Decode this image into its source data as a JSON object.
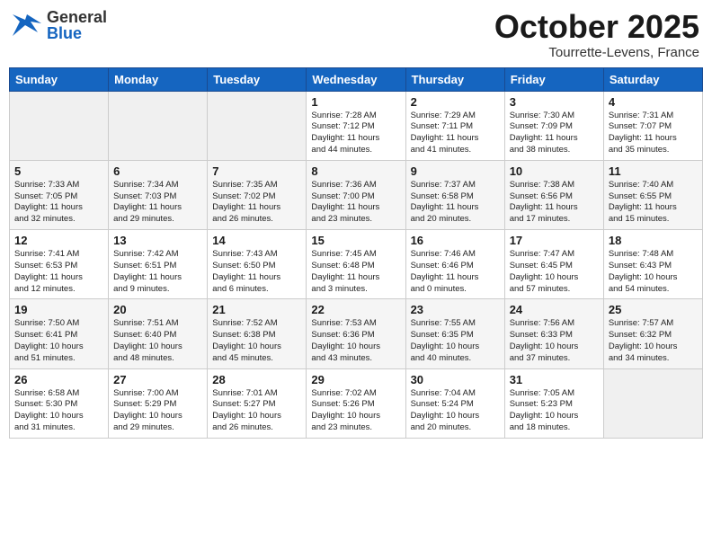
{
  "header": {
    "logo_general": "General",
    "logo_blue": "Blue",
    "month": "October 2025",
    "location": "Tourrette-Levens, France"
  },
  "days_of_week": [
    "Sunday",
    "Monday",
    "Tuesday",
    "Wednesday",
    "Thursday",
    "Friday",
    "Saturday"
  ],
  "weeks": [
    [
      {
        "day": "",
        "info": ""
      },
      {
        "day": "",
        "info": ""
      },
      {
        "day": "",
        "info": ""
      },
      {
        "day": "1",
        "info": "Sunrise: 7:28 AM\nSunset: 7:12 PM\nDaylight: 11 hours\nand 44 minutes."
      },
      {
        "day": "2",
        "info": "Sunrise: 7:29 AM\nSunset: 7:11 PM\nDaylight: 11 hours\nand 41 minutes."
      },
      {
        "day": "3",
        "info": "Sunrise: 7:30 AM\nSunset: 7:09 PM\nDaylight: 11 hours\nand 38 minutes."
      },
      {
        "day": "4",
        "info": "Sunrise: 7:31 AM\nSunset: 7:07 PM\nDaylight: 11 hours\nand 35 minutes."
      }
    ],
    [
      {
        "day": "5",
        "info": "Sunrise: 7:33 AM\nSunset: 7:05 PM\nDaylight: 11 hours\nand 32 minutes."
      },
      {
        "day": "6",
        "info": "Sunrise: 7:34 AM\nSunset: 7:03 PM\nDaylight: 11 hours\nand 29 minutes."
      },
      {
        "day": "7",
        "info": "Sunrise: 7:35 AM\nSunset: 7:02 PM\nDaylight: 11 hours\nand 26 minutes."
      },
      {
        "day": "8",
        "info": "Sunrise: 7:36 AM\nSunset: 7:00 PM\nDaylight: 11 hours\nand 23 minutes."
      },
      {
        "day": "9",
        "info": "Sunrise: 7:37 AM\nSunset: 6:58 PM\nDaylight: 11 hours\nand 20 minutes."
      },
      {
        "day": "10",
        "info": "Sunrise: 7:38 AM\nSunset: 6:56 PM\nDaylight: 11 hours\nand 17 minutes."
      },
      {
        "day": "11",
        "info": "Sunrise: 7:40 AM\nSunset: 6:55 PM\nDaylight: 11 hours\nand 15 minutes."
      }
    ],
    [
      {
        "day": "12",
        "info": "Sunrise: 7:41 AM\nSunset: 6:53 PM\nDaylight: 11 hours\nand 12 minutes."
      },
      {
        "day": "13",
        "info": "Sunrise: 7:42 AM\nSunset: 6:51 PM\nDaylight: 11 hours\nand 9 minutes."
      },
      {
        "day": "14",
        "info": "Sunrise: 7:43 AM\nSunset: 6:50 PM\nDaylight: 11 hours\nand 6 minutes."
      },
      {
        "day": "15",
        "info": "Sunrise: 7:45 AM\nSunset: 6:48 PM\nDaylight: 11 hours\nand 3 minutes."
      },
      {
        "day": "16",
        "info": "Sunrise: 7:46 AM\nSunset: 6:46 PM\nDaylight: 11 hours\nand 0 minutes."
      },
      {
        "day": "17",
        "info": "Sunrise: 7:47 AM\nSunset: 6:45 PM\nDaylight: 10 hours\nand 57 minutes."
      },
      {
        "day": "18",
        "info": "Sunrise: 7:48 AM\nSunset: 6:43 PM\nDaylight: 10 hours\nand 54 minutes."
      }
    ],
    [
      {
        "day": "19",
        "info": "Sunrise: 7:50 AM\nSunset: 6:41 PM\nDaylight: 10 hours\nand 51 minutes."
      },
      {
        "day": "20",
        "info": "Sunrise: 7:51 AM\nSunset: 6:40 PM\nDaylight: 10 hours\nand 48 minutes."
      },
      {
        "day": "21",
        "info": "Sunrise: 7:52 AM\nSunset: 6:38 PM\nDaylight: 10 hours\nand 45 minutes."
      },
      {
        "day": "22",
        "info": "Sunrise: 7:53 AM\nSunset: 6:36 PM\nDaylight: 10 hours\nand 43 minutes."
      },
      {
        "day": "23",
        "info": "Sunrise: 7:55 AM\nSunset: 6:35 PM\nDaylight: 10 hours\nand 40 minutes."
      },
      {
        "day": "24",
        "info": "Sunrise: 7:56 AM\nSunset: 6:33 PM\nDaylight: 10 hours\nand 37 minutes."
      },
      {
        "day": "25",
        "info": "Sunrise: 7:57 AM\nSunset: 6:32 PM\nDaylight: 10 hours\nand 34 minutes."
      }
    ],
    [
      {
        "day": "26",
        "info": "Sunrise: 6:58 AM\nSunset: 5:30 PM\nDaylight: 10 hours\nand 31 minutes."
      },
      {
        "day": "27",
        "info": "Sunrise: 7:00 AM\nSunset: 5:29 PM\nDaylight: 10 hours\nand 29 minutes."
      },
      {
        "day": "28",
        "info": "Sunrise: 7:01 AM\nSunset: 5:27 PM\nDaylight: 10 hours\nand 26 minutes."
      },
      {
        "day": "29",
        "info": "Sunrise: 7:02 AM\nSunset: 5:26 PM\nDaylight: 10 hours\nand 23 minutes."
      },
      {
        "day": "30",
        "info": "Sunrise: 7:04 AM\nSunset: 5:24 PM\nDaylight: 10 hours\nand 20 minutes."
      },
      {
        "day": "31",
        "info": "Sunrise: 7:05 AM\nSunset: 5:23 PM\nDaylight: 10 hours\nand 18 minutes."
      },
      {
        "day": "",
        "info": ""
      }
    ]
  ]
}
